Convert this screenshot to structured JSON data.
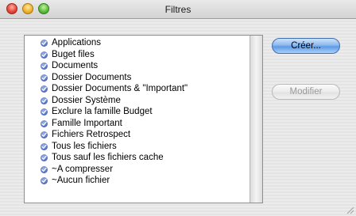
{
  "window": {
    "title": "Filtres"
  },
  "filters": {
    "items": [
      "Applications",
      "Buget files",
      "Documents",
      "Dossier Documents",
      "Dossier Documents & \"Important\"",
      "Dossier Système",
      "Exclure la famille Budget",
      "Famille Important",
      "Fichiers Retrospect",
      "Tous les fichiers",
      "Tous sauf les fichiers cache",
      "~A compresser",
      "~Aucun fichier"
    ]
  },
  "buttons": {
    "create_label": "Créer...",
    "modify_label": "Modifier"
  },
  "colors": {
    "accent": "#5d9ae4",
    "item_icon": "#5572c4"
  }
}
